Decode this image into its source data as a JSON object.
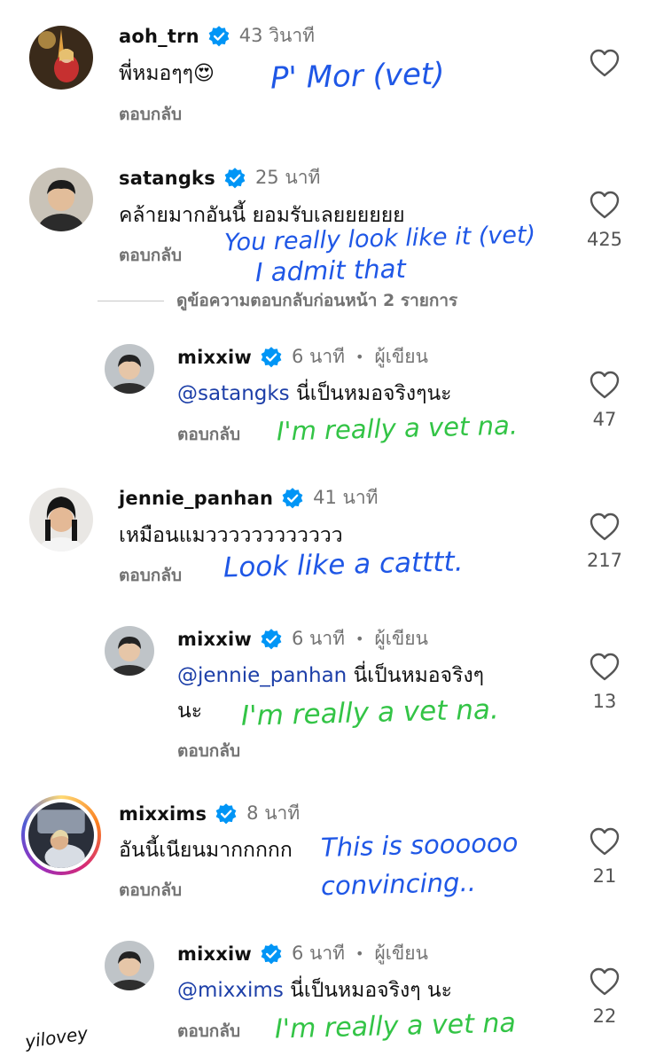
{
  "comments": [
    {
      "username": "aoh_trn",
      "time": "43 วินาที",
      "text": "พี่หมอๆๆ😍",
      "reply_label": "ตอบกลับ",
      "likes": "",
      "translation": "P' Mor (vet)"
    },
    {
      "username": "satangks",
      "time": "25 นาที",
      "text": "คล้ายมากอันนี้ ยอมรับเลยยยยยย",
      "reply_label": "ตอบกลับ",
      "likes": "425",
      "translation_line1": "You really look like it (vet)",
      "translation_line2": "I admit that",
      "view_previous": "ดูข้อความตอบกลับก่อนหน้า 2 รายการ",
      "replies": [
        {
          "username": "mixxiw",
          "time": "6 นาที",
          "author_label": "ผู้เขียน",
          "mention": "@satangks",
          "text": "นี่เป็นหมอจริงๆนะ",
          "reply_label": "ตอบกลับ",
          "likes": "47",
          "translation": "I'm really a vet na."
        }
      ]
    },
    {
      "username": "jennie_panhan",
      "time": "41 นาที",
      "text": "เหมือนแมวววววววววววว",
      "reply_label": "ตอบกลับ",
      "likes": "217",
      "translation": "Look like a catttt.",
      "replies": [
        {
          "username": "mixxiw",
          "time": "6 นาที",
          "author_label": "ผู้เขียน",
          "mention": "@jennie_panhan",
          "text_line1": "นี่เป็นหมอจริงๆ",
          "text_line2": "นะ",
          "reply_label": "ตอบกลับ",
          "likes": "13",
          "translation": "I'm really a vet na."
        }
      ]
    },
    {
      "username": "mixxims",
      "time": "8 นาที",
      "text": "อันนี้เนียนมากกกกก",
      "reply_label": "ตอบกลับ",
      "likes": "21",
      "translation_line1": "This is soooooo",
      "translation_line2": "convincing..",
      "replies": [
        {
          "username": "mixxiw",
          "time": "6 นาที",
          "author_label": "ผู้เขียน",
          "mention": "@mixxims",
          "text": "นี่เป็นหมอจริงๆ นะ",
          "reply_label": "ตอบกลับ",
          "likes": "22",
          "translation": "I'm really a vet na"
        }
      ]
    }
  ],
  "signature": "yilovey",
  "colors": {
    "verified": "#0095f6",
    "secondary_text": "#737373",
    "mention": "#1d3fa8",
    "annotation_blue": "#1f57e6",
    "annotation_green": "#33c446"
  },
  "icons": {
    "like": "heart-outline-icon",
    "verified": "verified-badge-icon"
  }
}
